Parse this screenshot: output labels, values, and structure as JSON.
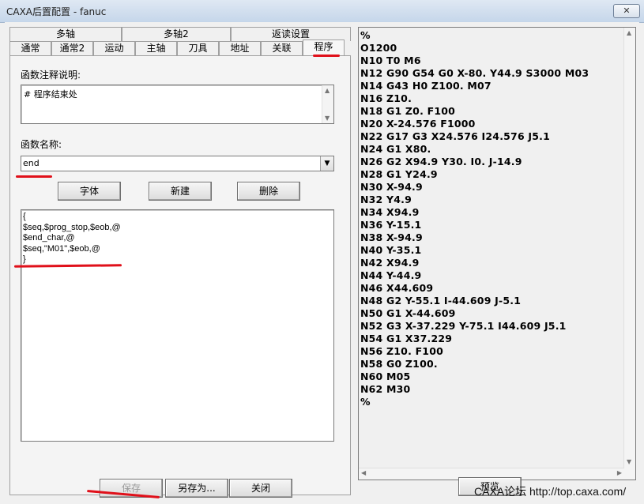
{
  "window": {
    "title": "CAXA后置配置 - fanuc",
    "close_label": "✕"
  },
  "tabs_top": [
    "多轴",
    "多轴2",
    "返读设置"
  ],
  "tabs_bottom": [
    "通常",
    "通常2",
    "运动",
    "主轴",
    "刀具",
    "地址",
    "关联",
    "程序"
  ],
  "active_tab": "程序",
  "form": {
    "comment_label": "函数注释说明:",
    "comment_value": "# 程序结束处",
    "name_label": "函数名称:",
    "name_value": "end",
    "font_button": "字体",
    "new_button": "新建",
    "delete_button": "删除",
    "body_lines": [
      "{",
      "$seq,$prog_stop,$eob,@",
      "$end_char,@",
      "$seq,\"M01\",$eob,@",
      "}"
    ]
  },
  "footer": {
    "save_button": "保存",
    "save_as_button": "另存为...",
    "close_button": "关闭",
    "preview_button": "预览"
  },
  "nc_program": [
    "%",
    "O1200",
    "N10 T0 M6",
    "N12 G90 G54 G0 X-80. Y44.9 S3000 M03",
    "N14 G43 H0 Z100. M07",
    "N16 Z10.",
    "N18 G1 Z0. F100",
    "N20 X-24.576 F1000",
    "N22 G17 G3 X24.576 I24.576 J5.1",
    "N24 G1 X80.",
    "N26 G2 X94.9 Y30. I0. J-14.9",
    "N28 G1 Y24.9",
    "N30 X-94.9",
    "N32 Y4.9",
    "N34 X94.9",
    "N36 Y-15.1",
    "N38 X-94.9",
    "N40 Y-35.1",
    "N42 X94.9",
    "N44 Y-44.9",
    "N46 X44.609",
    "N48 G2 Y-55.1 I-44.609 J-5.1",
    "N50 G1 X-44.609",
    "N52 G3 X-37.229 Y-75.1 I44.609 J5.1",
    "N54 G1 X37.229",
    "N56 Z10. F100",
    "N58 G0 Z100.",
    "N60 M05",
    "N62 M30",
    "%"
  ],
  "watermark": "CAXA论坛 http://top.caxa.com/",
  "colors": {
    "annotation_red": "#e0101a",
    "titlebar": "#c5d6ea"
  }
}
